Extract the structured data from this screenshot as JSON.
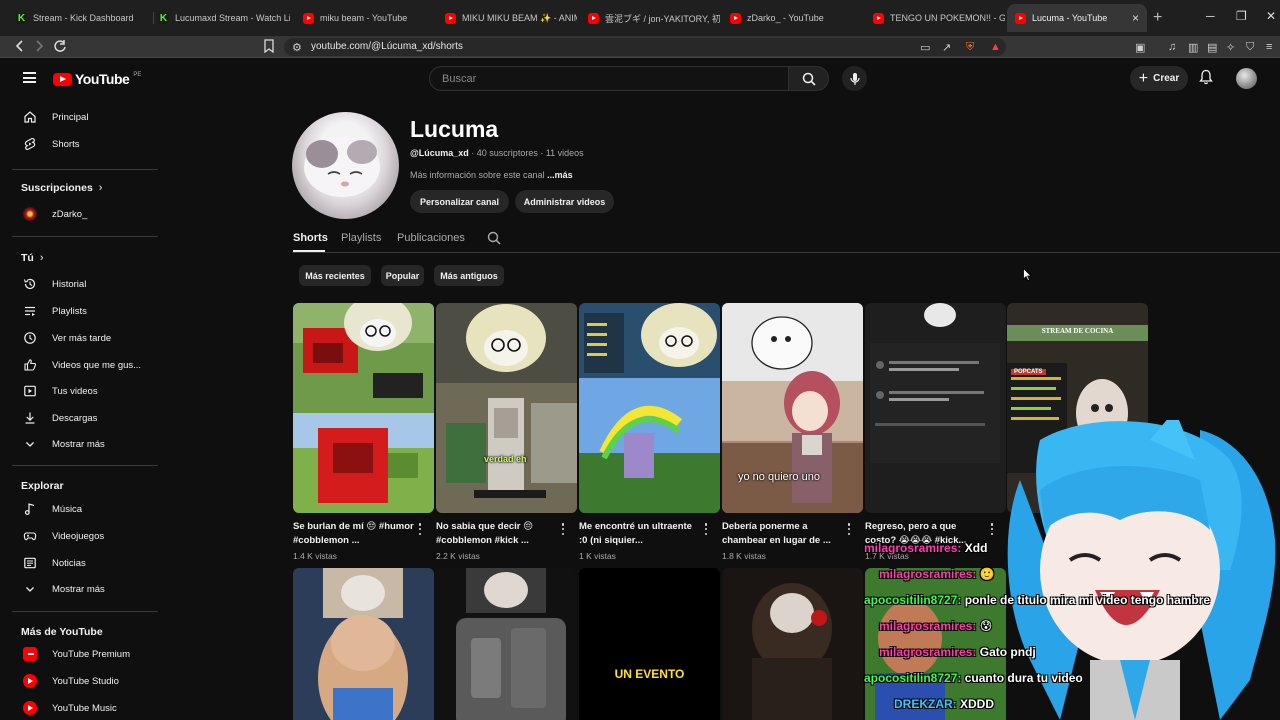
{
  "browser": {
    "tabs": [
      {
        "label": "Stream - Kick Dashboard",
        "favicon": "kick"
      },
      {
        "label": "Lucumaxd Stream - Watch Live",
        "favicon": "kick"
      },
      {
        "label": "miku beam - YouTube",
        "favicon": "youtube"
      },
      {
        "label": "MIKU MIKU BEAM ✨ - ANIMAT",
        "favicon": "youtube"
      },
      {
        "label": "雲泥ブギ / jon-YAKITORY, 初音",
        "favicon": "youtube"
      },
      {
        "label": "zDarko_ - YouTube",
        "favicon": "youtube"
      },
      {
        "label": "TENGO UN POKEMON!! - GYM",
        "favicon": "youtube"
      },
      {
        "label": "Lucuma - YouTube",
        "favicon": "youtube",
        "active": true
      }
    ],
    "url": "youtube.com/@Lúcuma_xd/shorts",
    "new_tab": "+",
    "win_min": "─",
    "win_max": "❐",
    "win_close": "✕"
  },
  "yt": {
    "logo_text": "YouTube",
    "country": "PE",
    "search_placeholder": "Buscar",
    "create_label": "Crear",
    "accent": "#ff0000"
  },
  "sidebar": {
    "main": [
      {
        "label": "Principal",
        "icon": "home-icon"
      },
      {
        "label": "Shorts",
        "icon": "shorts-icon"
      }
    ],
    "subs_header": "Suscripciones",
    "subs": [
      {
        "label": "zDarko_"
      }
    ],
    "you_header": "Tú",
    "you": [
      {
        "label": "Historial",
        "icon": "history-icon"
      },
      {
        "label": "Playlists",
        "icon": "playlists-icon"
      },
      {
        "label": "Ver más tarde",
        "icon": "watch-later-icon"
      },
      {
        "label": "Videos que me gus...",
        "icon": "like-icon"
      },
      {
        "label": "Tus videos",
        "icon": "your-videos-icon"
      },
      {
        "label": "Descargas",
        "icon": "download-icon"
      },
      {
        "label": "Mostrar más",
        "icon": "chevron-down-icon"
      }
    ],
    "explore_header": "Explorar",
    "explore": [
      {
        "label": "Música",
        "icon": "music-icon"
      },
      {
        "label": "Videojuegos",
        "icon": "gaming-icon"
      },
      {
        "label": "Noticias",
        "icon": "news-icon"
      },
      {
        "label": "Mostrar más",
        "icon": "chevron-down-icon"
      }
    ],
    "more_header": "Más de YouTube",
    "more": [
      {
        "label": "YouTube Premium"
      },
      {
        "label": "YouTube Studio"
      },
      {
        "label": "YouTube Music"
      }
    ]
  },
  "channel": {
    "name": "Lucuma",
    "handle": "@Lúcuma_xd",
    "stats": " · 40 suscriptores · 11 videos",
    "description": "Más información sobre este canal ",
    "more": "...más",
    "customize_label": "Personalizar canal",
    "manage_label": "Administrar videos",
    "tabs": [
      "Shorts",
      "Playlists",
      "Publicaciones"
    ],
    "active_tab": "Shorts",
    "chips": [
      "Más recientes",
      "Popular",
      "Más antiguos"
    ]
  },
  "shorts": [
    {
      "title": "Se burlan de mí 😔 #humor #cobblemon ...",
      "views": "1.4 K vistas"
    },
    {
      "title": "No sabia que decir 😔 #cobblemon #kick ...",
      "views": "2.2 K vistas",
      "caption": "verdad eh"
    },
    {
      "title": "Me encontré un ultraente :0 (ni siquier...",
      "views": "1 K vistas"
    },
    {
      "title": "Debería ponerme a chambear en lugar de ...",
      "views": "1.8 K vistas",
      "caption": "yo no quiero uno"
    },
    {
      "title": "Regreso, pero a que costo? 😭😭😭 #kick...",
      "views": "1.7 K vistas"
    },
    {
      "title": "",
      "views": "",
      "banner": "STREAM DE COCINA",
      "sign": "POPCATS"
    }
  ],
  "shorts_row2": [
    {
      "caption": ""
    },
    {
      "caption": ""
    },
    {
      "caption": "UN EVENTO"
    },
    {
      "caption": ""
    },
    {
      "caption": ""
    }
  ],
  "chat": [
    {
      "user": "milagrosramires:",
      "msg": "Xdd",
      "color": "pink"
    },
    {
      "user": "milagrosramires:",
      "msg": "🙂",
      "color": "pink"
    },
    {
      "user": "apocositilin8727:",
      "msg": "ponle de titulo mira mi video tengo hambre",
      "color": "green"
    },
    {
      "user": "milagrosramires:",
      "msg": "😰",
      "color": "pink"
    },
    {
      "user": "milagrosramires:",
      "msg": "Gato pndj",
      "color": "pink"
    },
    {
      "user": "apocositilin8727:",
      "msg": "cuanto dura tu video",
      "color": "green"
    },
    {
      "user": "DREKZAR:",
      "msg": "XDDD",
      "color": "blue"
    }
  ]
}
